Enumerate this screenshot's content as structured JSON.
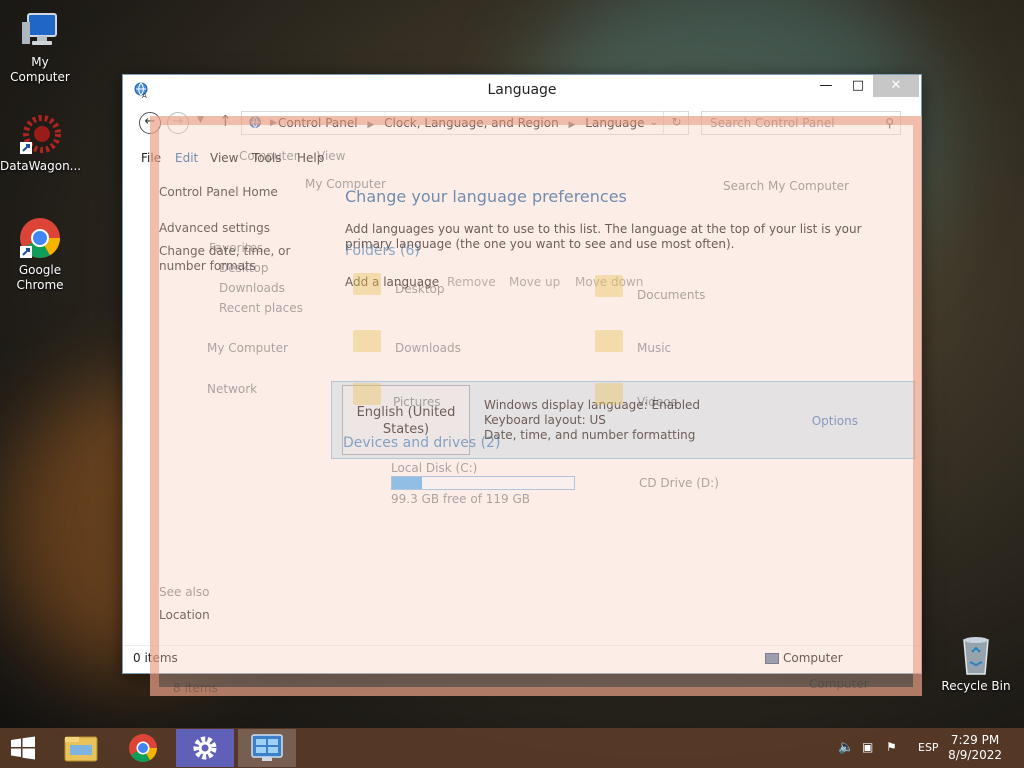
{
  "desktop": {
    "icons": [
      {
        "label": "My Computer"
      },
      {
        "label": "DataWagon..."
      },
      {
        "label": "Google Chrome"
      },
      {
        "label": "Recycle Bin"
      }
    ]
  },
  "window": {
    "title": "Language",
    "controls": {
      "minimize": "—",
      "maximize": "□",
      "close": "✕"
    },
    "breadcrumb": [
      "Control Panel",
      "Clock, Language, and Region",
      "Language"
    ],
    "search_placeholder": "Search Control Panel",
    "menu": [
      "File",
      "Edit",
      "View",
      "Tools",
      "Help"
    ],
    "left_pane": {
      "links": [
        "Control Panel Home",
        "Advanced settings",
        "Change date, time, or number formats"
      ],
      "see_also": "See also",
      "location": "Location"
    },
    "main": {
      "heading": "Change your language preferences",
      "description": "Add languages you want to use to this list. The language at the top of your list is your primary language (the one you want to see and use most often).",
      "actions": {
        "add": "Add a language",
        "remove": "Remove",
        "move_up": "Move up",
        "move_down": "Move down"
      },
      "language": {
        "name": "English (United States)",
        "info": [
          "Windows display language: Enabled",
          "Keyboard layout: US",
          "Date, time, and number formatting"
        ],
        "options": "Options"
      }
    },
    "status": {
      "items": "0 items",
      "computer": "Computer"
    }
  },
  "ghost_explorer": {
    "address": "My Computer",
    "search": "Search My Computer",
    "nav": [
      "Favorites",
      "Desktop",
      "Downloads",
      "Recent places",
      "My Computer",
      "Network"
    ],
    "folders_header": "Folders (6)",
    "folders": [
      "Desktop",
      "Documents",
      "Downloads",
      "Music",
      "Pictures",
      "Videos"
    ],
    "devices_header": "Devices and drives (2)",
    "drive_c": {
      "name": "Local Disk (C:)",
      "free": "99.3 GB free of 119 GB",
      "used_fraction": 0.166
    },
    "drive_d": "CD Drive (D:)",
    "status_items": "8 items",
    "status_computer": "Computer",
    "view_ghost": "View",
    "computer_ghost": "Computer"
  },
  "taskbar": {
    "lang": "ESP",
    "time": "7:29 PM",
    "date": "8/9/2022"
  },
  "colors": {
    "accent_blue": "#2b6aa8",
    "selection_bg": "#dceefa",
    "taskbar": "#5c3c28"
  }
}
